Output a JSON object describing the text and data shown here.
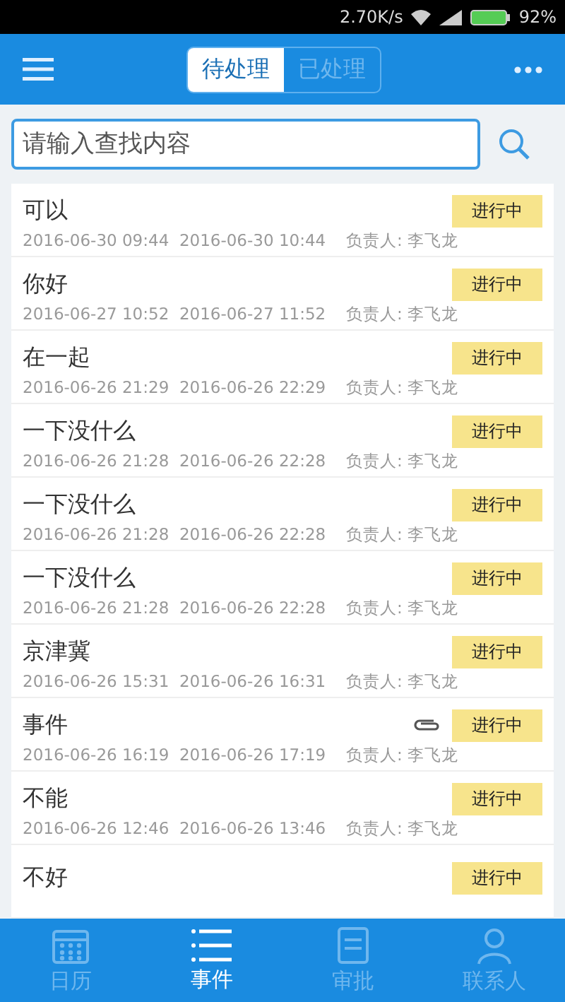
{
  "status_bar": {
    "speed": "2.70K/s",
    "battery": "92%"
  },
  "header": {
    "tabs": [
      {
        "label": "待处理",
        "selected": true
      },
      {
        "label": "已处理",
        "selected": false
      }
    ]
  },
  "search": {
    "placeholder": "请输入查找内容"
  },
  "events": [
    {
      "title": "可以",
      "start": "2016-06-30 09:44",
      "end": "2016-06-30 10:44",
      "owner": "负责人: 李飞龙",
      "status": "进行中",
      "attachment": false
    },
    {
      "title": "你好",
      "start": "2016-06-27 10:52",
      "end": "2016-06-27 11:52",
      "owner": "负责人: 李飞龙",
      "status": "进行中",
      "attachment": false
    },
    {
      "title": "在一起",
      "start": "2016-06-26 21:29",
      "end": "2016-06-26 22:29",
      "owner": "负责人: 李飞龙",
      "status": "进行中",
      "attachment": false
    },
    {
      "title": "一下没什么",
      "start": "2016-06-26 21:28",
      "end": "2016-06-26 22:28",
      "owner": "负责人: 李飞龙",
      "status": "进行中",
      "attachment": false
    },
    {
      "title": "一下没什么",
      "start": "2016-06-26 21:28",
      "end": "2016-06-26 22:28",
      "owner": "负责人: 李飞龙",
      "status": "进行中",
      "attachment": false
    },
    {
      "title": "一下没什么",
      "start": "2016-06-26 21:28",
      "end": "2016-06-26 22:28",
      "owner": "负责人: 李飞龙",
      "status": "进行中",
      "attachment": false
    },
    {
      "title": "京津冀",
      "start": "2016-06-26 15:31",
      "end": "2016-06-26 16:31",
      "owner": "负责人: 李飞龙",
      "status": "进行中",
      "attachment": false
    },
    {
      "title": "事件",
      "start": "2016-06-26 16:19",
      "end": "2016-06-26 17:19",
      "owner": "负责人: 李飞龙",
      "status": "进行中",
      "attachment": true
    },
    {
      "title": "不能",
      "start": "2016-06-26 12:46",
      "end": "2016-06-26 13:46",
      "owner": "负责人: 李飞龙",
      "status": "进行中",
      "attachment": false
    },
    {
      "title": "不好",
      "status": "进行中",
      "attachment": false
    }
  ],
  "bottom_nav": [
    {
      "label": "日历",
      "kind": "calendar",
      "selected": false
    },
    {
      "label": "事件",
      "kind": "list",
      "selected": true
    },
    {
      "label": "审批",
      "kind": "approve",
      "selected": false
    },
    {
      "label": "联系人",
      "kind": "contacts",
      "selected": false
    }
  ]
}
